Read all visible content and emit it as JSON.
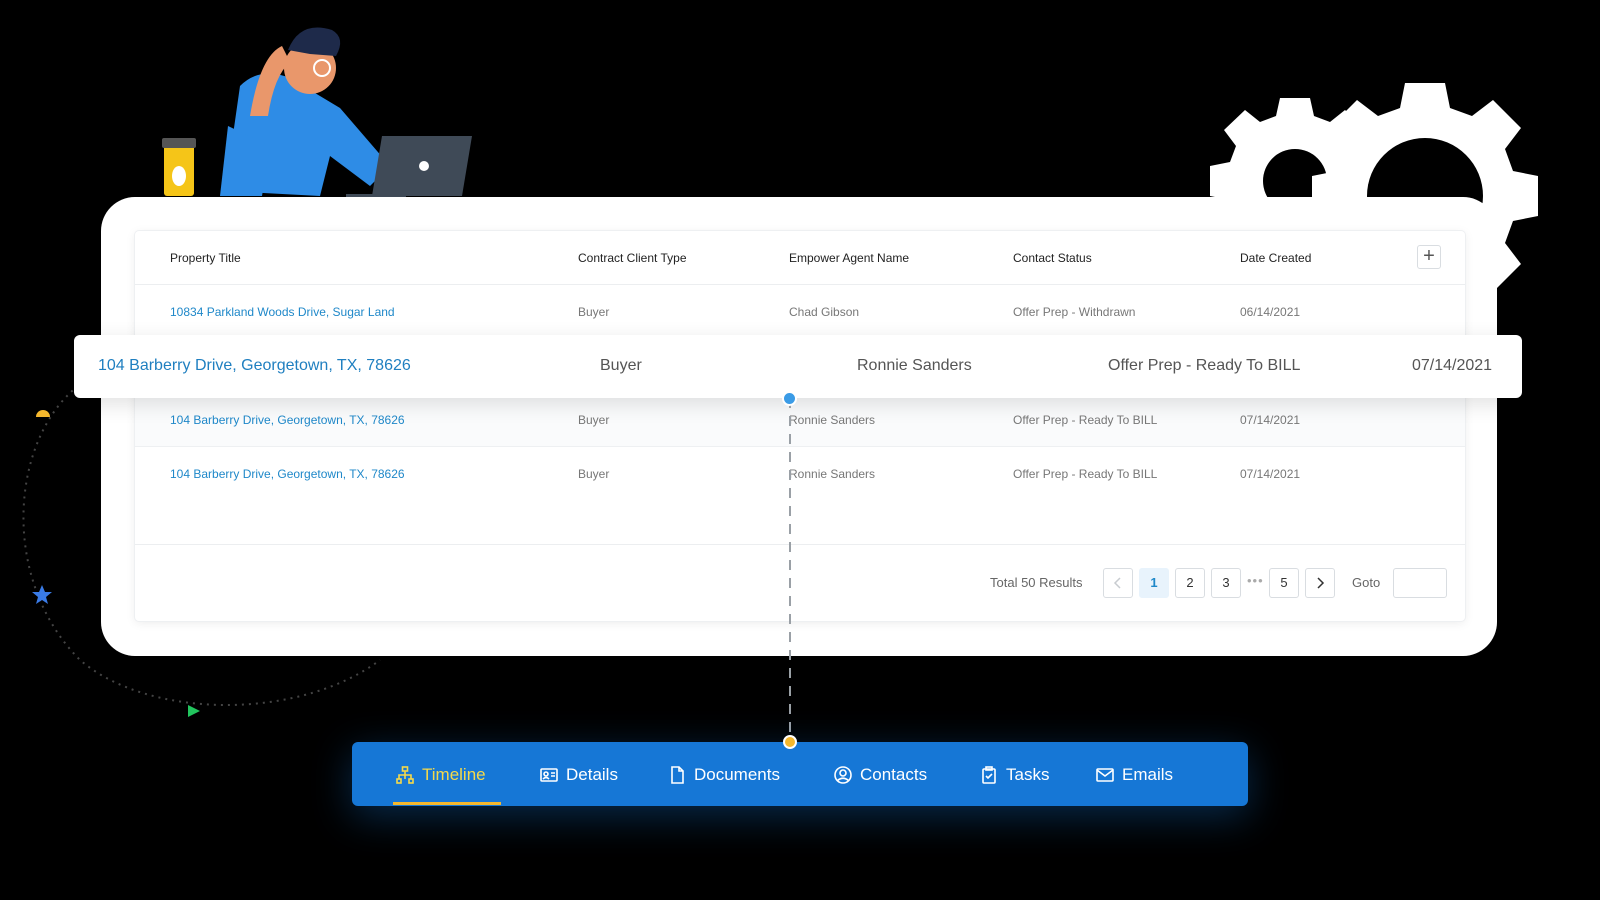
{
  "table": {
    "columns": [
      "Property Title",
      "Contract Client Type",
      "Empower Agent Name",
      "Contact Status",
      "Date Created"
    ],
    "add_button_icon": "plus-icon",
    "rows": [
      {
        "property_title": "10834 Parkland Woods Drive, Sugar Land",
        "client_type": "Buyer",
        "agent": "Chad Gibson",
        "status": "Offer Prep - Withdrawn",
        "date": "06/14/2021"
      },
      {
        "property_title": "104 Barberry Drive, Georgetown, TX, 78626",
        "client_type": "Buyer",
        "agent": "Ronnie Sanders",
        "status": "Offer Prep - Ready To BILL",
        "date": "07/14/2021"
      },
      {
        "property_title": "104 Barberry Drive, Georgetown, TX, 78626",
        "client_type": "Buyer",
        "agent": "Ronnie Sanders",
        "status": "Offer Prep - Ready To BILL",
        "date": "07/14/2021"
      }
    ],
    "highlighted_row": {
      "property_title": "104 Barberry Drive, Georgetown, TX, 78626",
      "client_type": "Buyer",
      "agent": "Ronnie Sanders",
      "status": "Offer Prep - Ready To BILL",
      "date": "07/14/2021"
    }
  },
  "pagination": {
    "total_text": "Total 50 Results",
    "pages": [
      "1",
      "2",
      "3",
      "5"
    ],
    "ellipsis": "•••",
    "active_page": "1",
    "goto_label": "Goto",
    "prev_icon": "chevron-left-icon",
    "next_icon": "chevron-right-icon"
  },
  "tabs": [
    {
      "label": "Timeline",
      "icon": "sitemap-icon",
      "active": true
    },
    {
      "label": "Details",
      "icon": "id-card-icon",
      "active": false
    },
    {
      "label": "Documents",
      "icon": "document-icon",
      "active": false
    },
    {
      "label": "Contacts",
      "icon": "user-circle-icon",
      "active": false
    },
    {
      "label": "Tasks",
      "icon": "clipboard-check-icon",
      "active": false
    },
    {
      "label": "Emails",
      "icon": "envelope-icon",
      "active": false
    }
  ],
  "colors": {
    "link": "#1f88c9",
    "tabbar": "#1677d6",
    "active_tab": "#f5d94a",
    "accent_yellow": "#f5b82e",
    "accent_blue": "#3a9be6"
  }
}
